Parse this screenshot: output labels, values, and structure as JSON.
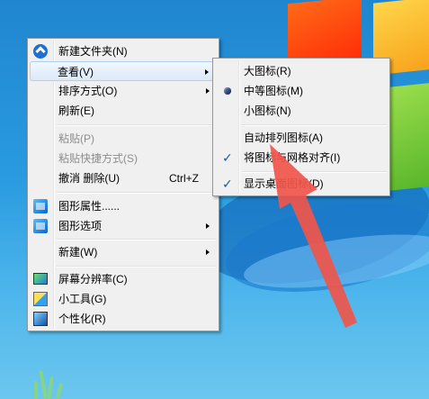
{
  "context_menu": {
    "items": [
      {
        "label": "新建文件夹(N)",
        "icon": "new-folder-icon"
      },
      {
        "label": "查看(V)",
        "submenu": true,
        "highlighted": true
      },
      {
        "label": "排序方式(O)",
        "submenu": true
      },
      {
        "label": "刷新(E)"
      },
      {
        "label": "粘贴(P)",
        "disabled": true
      },
      {
        "label": "粘贴快捷方式(S)",
        "disabled": true
      },
      {
        "label": "撤消 删除(U)",
        "shortcut": "Ctrl+Z"
      },
      {
        "label": "图形属性......",
        "icon": "graphics-properties-icon"
      },
      {
        "label": "图形选项",
        "submenu": true,
        "icon": "graphics-options-icon"
      },
      {
        "label": "新建(W)",
        "submenu": true
      },
      {
        "label": "屏幕分辨率(C)",
        "icon": "screen-resolution-icon"
      },
      {
        "label": "小工具(G)",
        "icon": "gadgets-icon"
      },
      {
        "label": "个性化(R)",
        "icon": "personalize-icon"
      }
    ]
  },
  "view_submenu": {
    "items": [
      {
        "label": "大图标(R)"
      },
      {
        "label": "中等图标(M)",
        "selected": true
      },
      {
        "label": "小图标(N)"
      },
      {
        "label": "自动排列图标(A)"
      },
      {
        "label": "将图标与网格对齐(I)",
        "checked": true
      },
      {
        "label": "显示桌面图标(D)",
        "checked": true
      }
    ]
  },
  "annotation": {
    "color": "#f0554a",
    "type": "red-arrow"
  }
}
